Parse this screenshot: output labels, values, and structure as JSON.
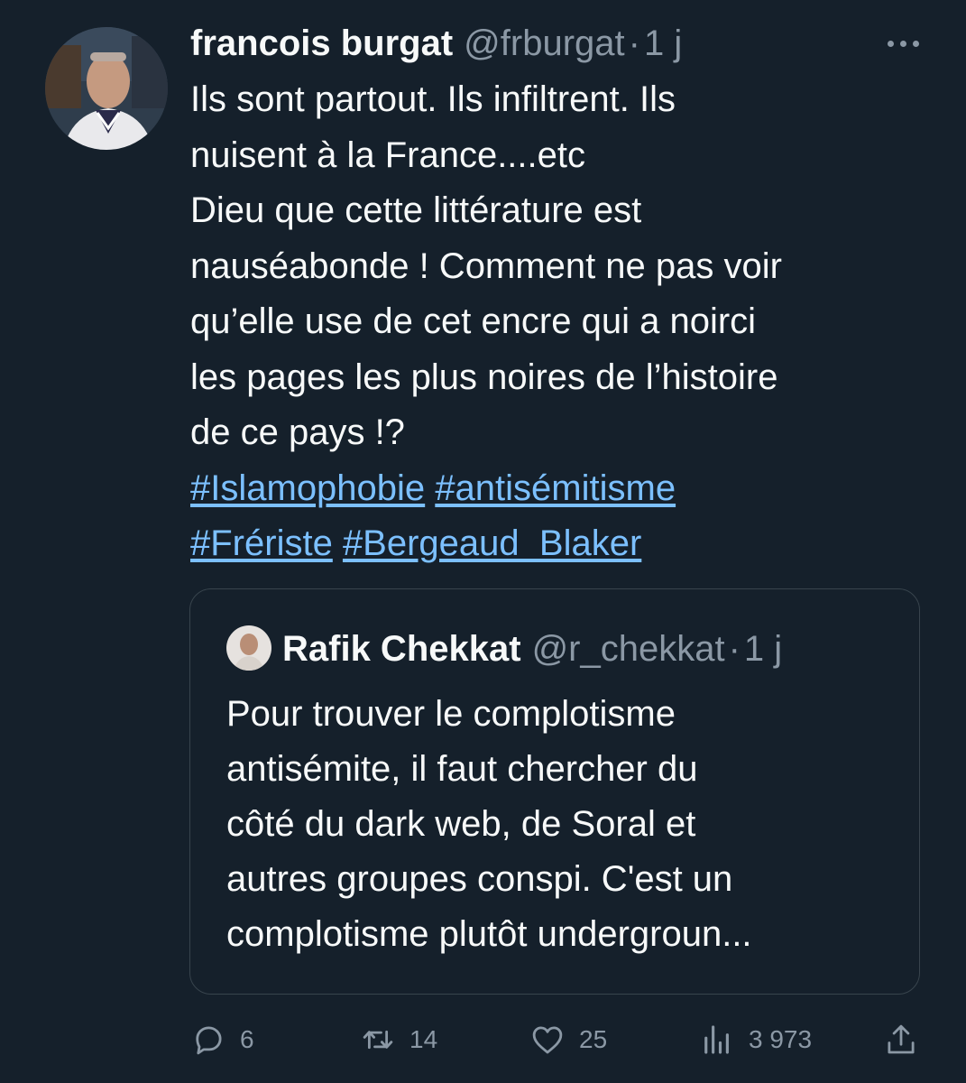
{
  "tweet": {
    "author_name": "francois burgat",
    "author_handle": "@frburgat",
    "separator": "·",
    "time": "1 j",
    "text_lines": [
      "Ils sont partout. Ils infiltrent. Ils",
      "nuisent à la France....etc",
      "Dieu que cette littérature est",
      "nauséabonde ! Comment ne pas voir",
      "qu’elle use de cet encre qui a noirci",
      "les pages les plus noires de l’histoire",
      "de ce pays !?"
    ],
    "hashtags": [
      "#Islamophobie",
      "#antisémitisme",
      "#Frériste",
      "#Bergeaud_Blaker"
    ]
  },
  "quoted_tweet": {
    "author_name": "Rafik Chekkat",
    "author_handle": "@r_chekkat",
    "separator": "·",
    "time": "1 j",
    "text_lines": [
      "Pour trouver le complotisme",
      "antisémite, il faut chercher du",
      "côté du dark web, de Soral et",
      "autres groupes conspi. C'est un",
      "complotisme plutôt undergroun..."
    ]
  },
  "actions": {
    "replies": "6",
    "retweets": "14",
    "likes": "25",
    "views": "3 973"
  },
  "icons": {
    "more": "more-horizontal-icon",
    "reply": "reply-icon",
    "retweet": "retweet-icon",
    "like": "heart-icon",
    "views": "views-chart-icon",
    "share": "share-icon"
  },
  "colors": {
    "background": "#15202b",
    "text": "#f7f9f9",
    "secondary": "#8b98a5",
    "hashtag": "#7cc0ff",
    "border": "#38444d"
  }
}
